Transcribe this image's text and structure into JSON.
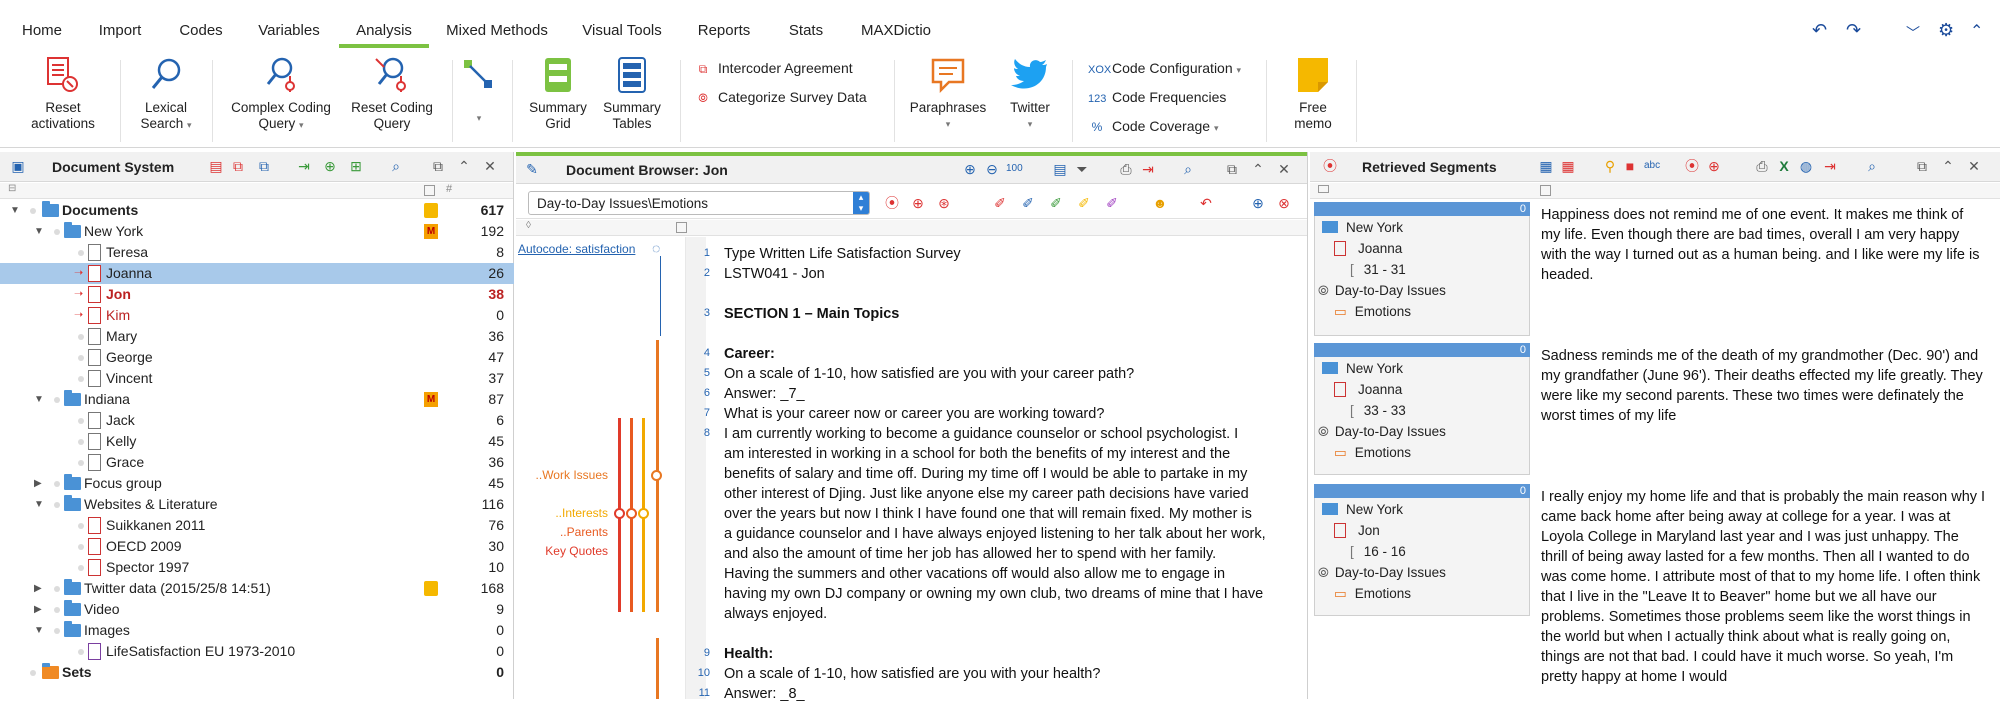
{
  "menu": {
    "tabs": [
      "Home",
      "Import",
      "Codes",
      "Variables",
      "Analysis",
      "Mixed Methods",
      "Visual Tools",
      "Reports",
      "Stats",
      "MAXDictio"
    ],
    "active": "Analysis"
  },
  "ribbon": {
    "reset_activations": "Reset\nactivations",
    "lexical_search_1": "Lexical",
    "lexical_search_2": "Search",
    "complex_query_1": "Complex Coding",
    "complex_query_2": "Query",
    "reset_query_1": "Reset Coding",
    "reset_query_2": "Query",
    "summary_grid_1": "Summary",
    "summary_grid_2": "Grid",
    "summary_tables_1": "Summary",
    "summary_tables_2": "Tables",
    "intercoder": "Intercoder Agreement",
    "categorize": "Categorize Survey Data",
    "paraphrases": "Paraphrases",
    "twitter": "Twitter",
    "code_configuration": "Code Configuration",
    "code_frequencies": "Code Frequencies",
    "code_coverage": "Code Coverage",
    "free_memo_1": "Free",
    "free_memo_2": "memo",
    "reset_1": "Reset",
    "reset_2": "activations"
  },
  "document_system": {
    "title": "Document System",
    "rows": [
      {
        "label": "Documents",
        "count": "617"
      },
      {
        "label": "New York",
        "count": "192"
      },
      {
        "label": "Teresa",
        "count": "8"
      },
      {
        "label": "Joanna",
        "count": "26"
      },
      {
        "label": "Jon",
        "count": "38"
      },
      {
        "label": "Kim",
        "count": "0"
      },
      {
        "label": "Mary",
        "count": "36"
      },
      {
        "label": "George",
        "count": "47"
      },
      {
        "label": "Vincent",
        "count": "37"
      },
      {
        "label": "Indiana",
        "count": "87"
      },
      {
        "label": "Jack",
        "count": "6"
      },
      {
        "label": "Kelly",
        "count": "45"
      },
      {
        "label": "Grace",
        "count": "36"
      },
      {
        "label": "Focus group",
        "count": "45"
      },
      {
        "label": "Websites & Literature",
        "count": "116"
      },
      {
        "label": "Suikkanen 2011",
        "count": "76"
      },
      {
        "label": "OECD 2009",
        "count": "30"
      },
      {
        "label": "Spector 1997",
        "count": "10"
      },
      {
        "label": "Twitter data (2015/25/8 14:51)",
        "count": "168"
      },
      {
        "label": "Video",
        "count": "9"
      },
      {
        "label": "Images",
        "count": "0"
      },
      {
        "label": "LifeSatisfaction EU 1973-2010",
        "count": "0"
      },
      {
        "label": "Sets",
        "count": "0"
      }
    ]
  },
  "document_browser": {
    "title": "Document Browser: Jon",
    "code_path": "Day-to-Day Issues\\Emotions",
    "autocode": "Autocode: satisfaction",
    "code_labels": [
      "..Work Issues",
      "..Interests",
      "..Parents",
      "Key Quotes"
    ],
    "lines": [
      {
        "n": "1",
        "text": "Type Written Life Satisfaction Survey",
        "bold": false
      },
      {
        "n": "2",
        "text": "LSTW041 - Jon",
        "bold": false
      },
      {
        "n": "3",
        "text": "SECTION 1 – Main Topics",
        "bold": true
      },
      {
        "n": "4",
        "text": "Career:",
        "bold": true
      },
      {
        "n": "5",
        "text": "On a scale of 1-10, how satisfied are you with your career path?",
        "bold": false
      },
      {
        "n": "6",
        "text": "Answer: _7_",
        "bold": false
      },
      {
        "n": "7",
        "text": "What is your career now or career you are working toward?",
        "bold": false
      },
      {
        "n": "8",
        "text": "I am currently working to become a guidance counselor or school psychologist.  I",
        "bold": false
      },
      {
        "n": "",
        "text": "am interested in working in a school for both the benefits of my interest and the",
        "bold": false
      },
      {
        "n": "",
        "text": "benefits of salary and time off.  During my time off I would be able to partake in my",
        "bold": false
      },
      {
        "n": "",
        "text": "other interest of Djing.   Just like anyone else my career path decisions have varied",
        "bold": false
      },
      {
        "n": "",
        "text": "over the years but now I think I have found one that will remain fixed.  My mother is",
        "bold": false
      },
      {
        "n": "",
        "text": "a guidance counselor and I have always enjoyed listening to her talk about her work,",
        "bold": false
      },
      {
        "n": "",
        "text": "and also the amount of time her job has allowed her to spend with her family.",
        "bold": false
      },
      {
        "n": "",
        "text": "Having the summers and other vacations off would also allow me to engage in",
        "bold": false
      },
      {
        "n": "",
        "text": "having my own DJ company or owning my own club, two dreams of mine that I have",
        "bold": false
      },
      {
        "n": "",
        "text": "always enjoyed.",
        "bold": false
      },
      {
        "n": "9",
        "text": "Health:",
        "bold": true
      },
      {
        "n": "10",
        "text": "On a scale of 1-10, how satisfied are you with your health?",
        "bold": false
      },
      {
        "n": "11",
        "text": "Answer: _8_",
        "bold": false
      }
    ]
  },
  "retrieved_segments": {
    "title": "Retrieved Segments",
    "segments": [
      {
        "weight": "0",
        "group": "New York",
        "doc": "Joanna",
        "range": "31 - 31",
        "code_parent": "Day-to-Day Issues",
        "code": "Emotions",
        "text": "Happiness does not remind me of one event. It makes me think of my life.  Even though there are bad times, overall I am very happy with the way I turned out as a human being. and I like were my life is headed."
      },
      {
        "weight": "0",
        "group": "New York",
        "doc": "Joanna",
        "range": "33 - 33",
        "code_parent": "Day-to-Day Issues",
        "code": "Emotions",
        "text": "Sadness reminds me of the death of my grandmother (Dec. 90') and my grandfather (June 96').  Their deaths effected my life greatly. They were like my second parents.  These two times were definately the worst times of my life"
      },
      {
        "weight": "0",
        "group": "New York",
        "doc": "Jon",
        "range": "16 - 16",
        "code_parent": "Day-to-Day Issues",
        "code": "Emotions",
        "text": "I really enjoy my home life and that is probably the main reason why I came back home after being away at college for a year.  I was at Loyola College in Maryland last year and I was just unhappy.  The thrill of being away lasted for a few months.  Then all I wanted to do was come home.  I attribute most of that to my home life.  I often think that I live in the \"Leave It to Beaver\" home but we all have our problems.  Sometimes those problems seem like the worst things in the world but when I actually think about what is really going on, things are not that bad.  I could have it much worse.  So yeah, I'm pretty happy at home I would"
      }
    ]
  },
  "colors": {
    "accent_green": "#7cc242",
    "selection": "#a8c9ea",
    "folder_blue": "#4a92d6",
    "code_orange": "#e87722",
    "segment_header": "#5b96d6"
  }
}
